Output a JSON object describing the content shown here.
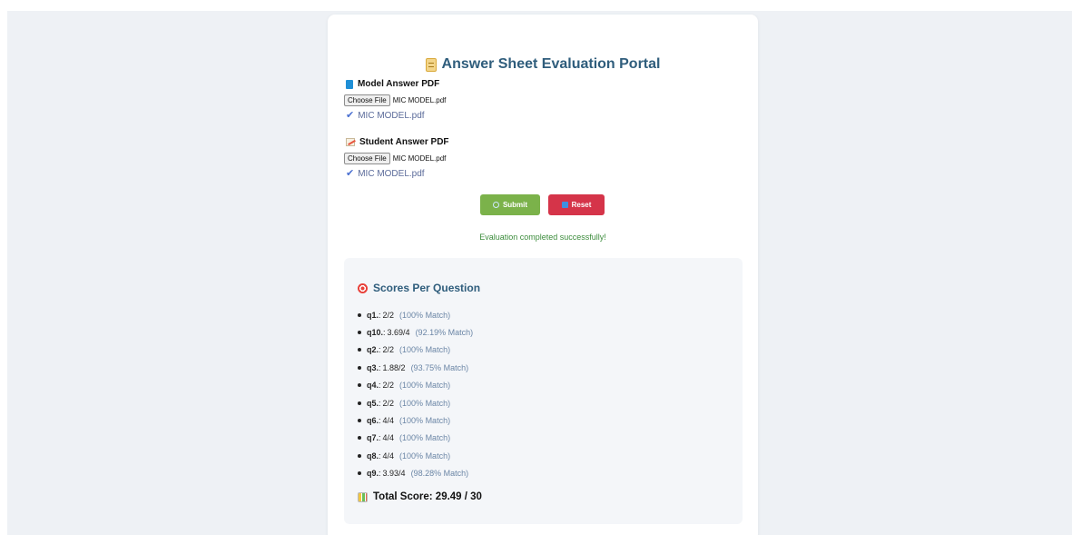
{
  "title": "Answer Sheet Evaluation Portal",
  "model_answer": {
    "label": "Model Answer PDF",
    "choose_button": "Choose File",
    "file_name": "MIC MODEL.pdf",
    "selected": "MIC MODEL.pdf"
  },
  "student_answer": {
    "label": "Student Answer PDF",
    "choose_button": "Choose File",
    "file_name": "MIC MODEL.pdf",
    "selected": "MIC MODEL.pdf"
  },
  "buttons": {
    "submit": "Submit",
    "reset": "Reset"
  },
  "status": "Evaluation completed successfully!",
  "scores": {
    "title": "Scores Per Question",
    "items": [
      {
        "q": "q1.",
        "score": "2/2",
        "match": "(100% Match)"
      },
      {
        "q": "q10.",
        "score": "3.69/4",
        "match": "(92.19% Match)"
      },
      {
        "q": "q2.",
        "score": "2/2",
        "match": "(100% Match)"
      },
      {
        "q": "q3.",
        "score": "1.88/2",
        "match": "(93.75% Match)"
      },
      {
        "q": "q4.",
        "score": "2/2",
        "match": "(100% Match)"
      },
      {
        "q": "q5.",
        "score": "2/2",
        "match": "(100% Match)"
      },
      {
        "q": "q6.",
        "score": "4/4",
        "match": "(100% Match)"
      },
      {
        "q": "q7.",
        "score": "4/4",
        "match": "(100% Match)"
      },
      {
        "q": "q8.",
        "score": "4/4",
        "match": "(100% Match)"
      },
      {
        "q": "q9.",
        "score": "3.93/4",
        "match": "(98.28% Match)"
      }
    ],
    "total": "Total Score: 29.49 / 30"
  },
  "colors": {
    "title": "#2f5d7c",
    "submit": "#7bb24a",
    "reset": "#d53449",
    "success": "#3c8c3c",
    "match": "#6b86a6"
  }
}
